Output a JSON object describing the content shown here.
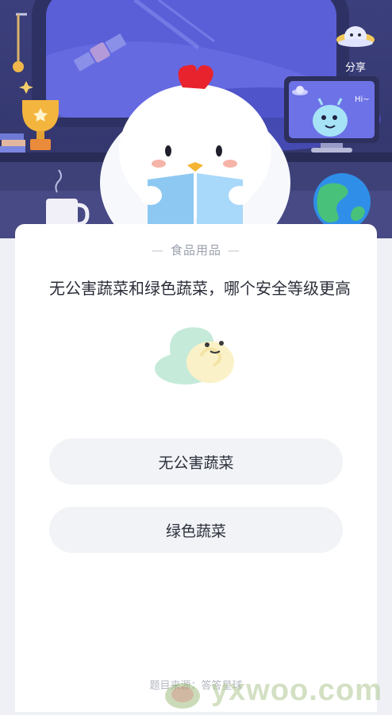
{
  "share": {
    "label": "分享"
  },
  "quiz": {
    "category": "食品用品",
    "question": "无公害蔬菜和绿色蔬菜，哪个安全等级更高",
    "options": [
      "无公害蔬菜",
      "绿色蔬菜"
    ],
    "source": "题目来源：答答星球"
  },
  "monitor": {
    "greeting": "Hi~"
  },
  "watermark": {
    "text": "yxwoo.com"
  },
  "colors": {
    "header_bg": "#3b3f7c",
    "card_bg": "#ffffff",
    "option_bg": "#f1f3f7",
    "text": "#2b2f3a",
    "muted": "#9aa0ad"
  }
}
